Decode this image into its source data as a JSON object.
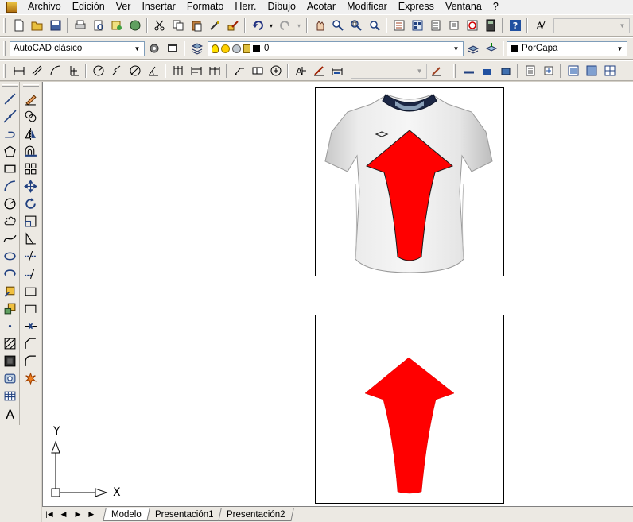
{
  "menu": {
    "items": [
      "Archivo",
      "Edición",
      "Ver",
      "Insertar",
      "Formato",
      "Herr.",
      "Dibujo",
      "Acotar",
      "Modificar",
      "Express",
      "Ventana",
      "?"
    ]
  },
  "toolbar2": {
    "workspace": "AutoCAD clásico",
    "layer": "0",
    "color": "PorCapa"
  },
  "ucs": {
    "x_label": "X",
    "y_label": "Y"
  },
  "tabs": {
    "model": "Modelo",
    "layout1": "Presentación1",
    "layout2": "Presentación2"
  },
  "colors": {
    "accent_red": "#ff0000",
    "canvas": "#ffffff"
  }
}
